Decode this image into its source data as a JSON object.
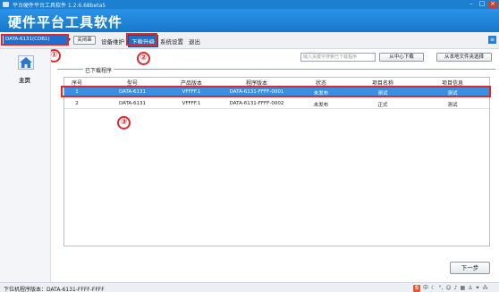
{
  "window": {
    "title": "平台硬件平台工具软件 1.2.6.68beta5",
    "controls": [
      "minimize",
      "maximize",
      "close"
    ]
  },
  "banner": {
    "app_title": "硬件平台工具软件"
  },
  "toolbar": {
    "device_select_value": "DATA-6131(CDB1)",
    "close_device_label": "关闭串",
    "menu_items": [
      {
        "label": "设备维护",
        "active": false
      },
      {
        "label": "下载升级",
        "active": true
      },
      {
        "label": "系统设置",
        "active": false
      },
      {
        "label": "退出",
        "active": false
      }
    ]
  },
  "sidebar": {
    "home_label": "主页",
    "home_icon": "home-icon"
  },
  "actions": {
    "search_placeholder": "输入关键字搜索已下载程序",
    "download_center_label": "从中心下载",
    "local_select_label": "从本地文件夹选择"
  },
  "section": {
    "title": "已下载程序"
  },
  "table": {
    "headers": [
      "序号",
      "型号",
      "产品版本",
      "程序版本",
      "状态",
      "项目名称",
      "项目信息"
    ],
    "rows": [
      {
        "cells": [
          "1",
          "DATA-6131",
          "VFFFF.1",
          "DATA-6131-FFFF-0001",
          "未发布",
          "测试",
          "测试"
        ],
        "selected": true
      },
      {
        "cells": [
          "2",
          "DATA-6131",
          "VFFFF.1",
          "DATA-6131-FFFF-0002",
          "未发布",
          "正式",
          "测试"
        ],
        "selected": false
      }
    ]
  },
  "annotations": {
    "color": "#e3262b",
    "markers": [
      "①",
      "②",
      "③"
    ]
  },
  "footer": {
    "next_label": "下一步",
    "status_text": "下位机程序版本：DATA-6131-FFFF-FFFF",
    "tray_ime": "S"
  },
  "colors": {
    "brand_blue": "#1f7fd1",
    "selected_row": "#3a8fe0",
    "annotation_red": "#e3262b"
  }
}
